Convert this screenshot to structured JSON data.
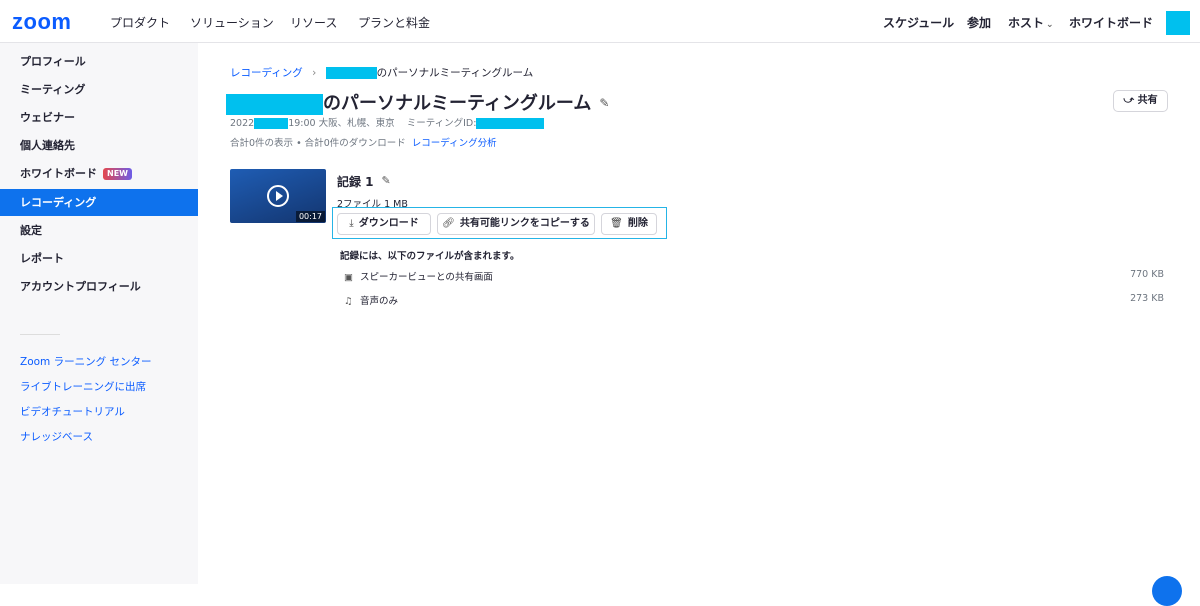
{
  "header": {
    "logo": "zoom",
    "nav_left": [
      "プロダクト",
      "ソリューション",
      "リソース",
      "プランと料金"
    ],
    "nav_right": {
      "schedule": "スケジュール",
      "join": "参加",
      "host": "ホスト",
      "whiteboard": "ホワイトボード"
    }
  },
  "sidebar": {
    "items": [
      "プロフィール",
      "ミーティング",
      "ウェビナー",
      "個人連絡先",
      "ホワイトボード",
      "レコーディング",
      "設定",
      "レポート",
      "アカウントプロフィール"
    ],
    "active_item": "レコーディング",
    "new_badge": "NEW",
    "links": [
      "Zoom ラーニング センター",
      "ライブトレーニングに出席",
      "ビデオチュートリアル",
      "ナレッジベース"
    ]
  },
  "main": {
    "breadcrumb": {
      "root": "レコーディング",
      "sep": "›",
      "current_suffix": "のパーソナルミーティングルーム"
    },
    "title_suffix": "のパーソナルミーティングルーム",
    "meta": {
      "year": "2022",
      "time_tz": "19:00 大阪、札幌、東京",
      "meeting_id_label": "ミーティングID:"
    },
    "stats": {
      "text": "合計0件の表示 • 合計0件のダウンロード",
      "analysis_link": "レコーディング分析"
    },
    "share_button": "共有",
    "recording": {
      "title": "記録 1",
      "duration": "00:17",
      "summary": "2ファイル  1 MB",
      "actions": {
        "download": "ダウンロード",
        "copy_link": "共有可能リンクをコピーする",
        "delete": "削除"
      },
      "files_heading": "記録には、以下のファイルが含まれます。",
      "files": [
        {
          "icon": "screen-share-icon",
          "name": "スピーカービューとの共有画面",
          "size": "770 KB"
        },
        {
          "icon": "music-note-icon",
          "name": "音声のみ",
          "size": "273 KB"
        }
      ]
    }
  },
  "colors": {
    "brand": "#0b5cff",
    "active": "#0e72ed",
    "redaction": "#00c0ee",
    "highlight": "#25b4e6"
  }
}
